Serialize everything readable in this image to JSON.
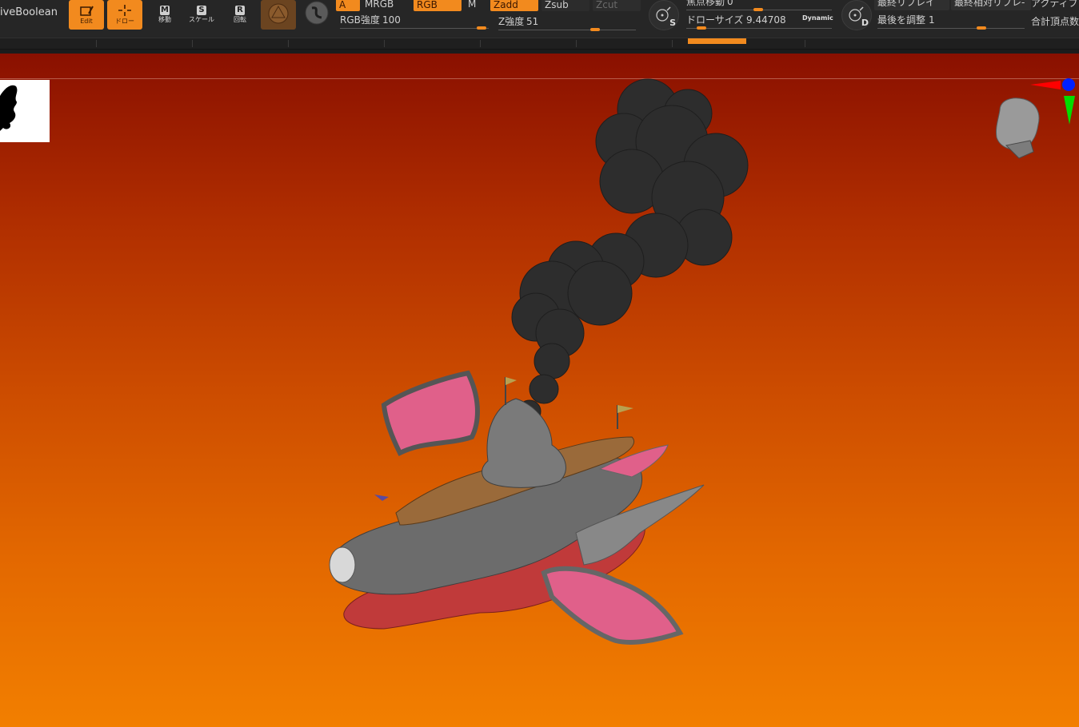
{
  "toolbar": {
    "plugin_label": "iveBoolean",
    "buttons": {
      "edit": "Edit",
      "draw": "ドロー",
      "move": "移動",
      "scale": "スケール",
      "rotate": "回転",
      "move_key": "M",
      "scale_key": "S",
      "rotate_key": "R"
    },
    "color_modes": {
      "a": "A",
      "mrgb": "MRGB",
      "rgb": "RGB",
      "m": "M",
      "zadd": "Zadd",
      "zsub": "Zsub",
      "zcut": "Zcut"
    },
    "rgb_intensity": {
      "label": "RGB強度",
      "value": "100"
    },
    "z_intensity": {
      "label": "Z強度",
      "value": "51"
    },
    "focal_shift": {
      "label": "焦点移動",
      "value": "0"
    },
    "draw_size": {
      "label": "ドローサイズ",
      "value": "9.44708"
    },
    "dynamic_label": "Dynamic",
    "s_icon_key": "S",
    "d_icon_key": "D",
    "last_replay": "最終リプレイ",
    "last_rel_replay": "最終相対リプレ-",
    "adjust_last": {
      "label": "最後を調整",
      "value": "1"
    },
    "active_label": "アクティブ",
    "total_points_label": "合計頂点数"
  },
  "colors": {
    "accent": "#f28a1e",
    "toolbar_bg": "#262626",
    "viewport_top": "#8a1000",
    "viewport_bottom": "#f27f00"
  },
  "icons": [
    "edit-icon",
    "draw-icon",
    "move-icon",
    "scale-icon",
    "rotate-icon",
    "material-icon",
    "stroke-icon",
    "s-brush-icon",
    "d-brush-icon",
    "navigation-gizmo-icon"
  ]
}
